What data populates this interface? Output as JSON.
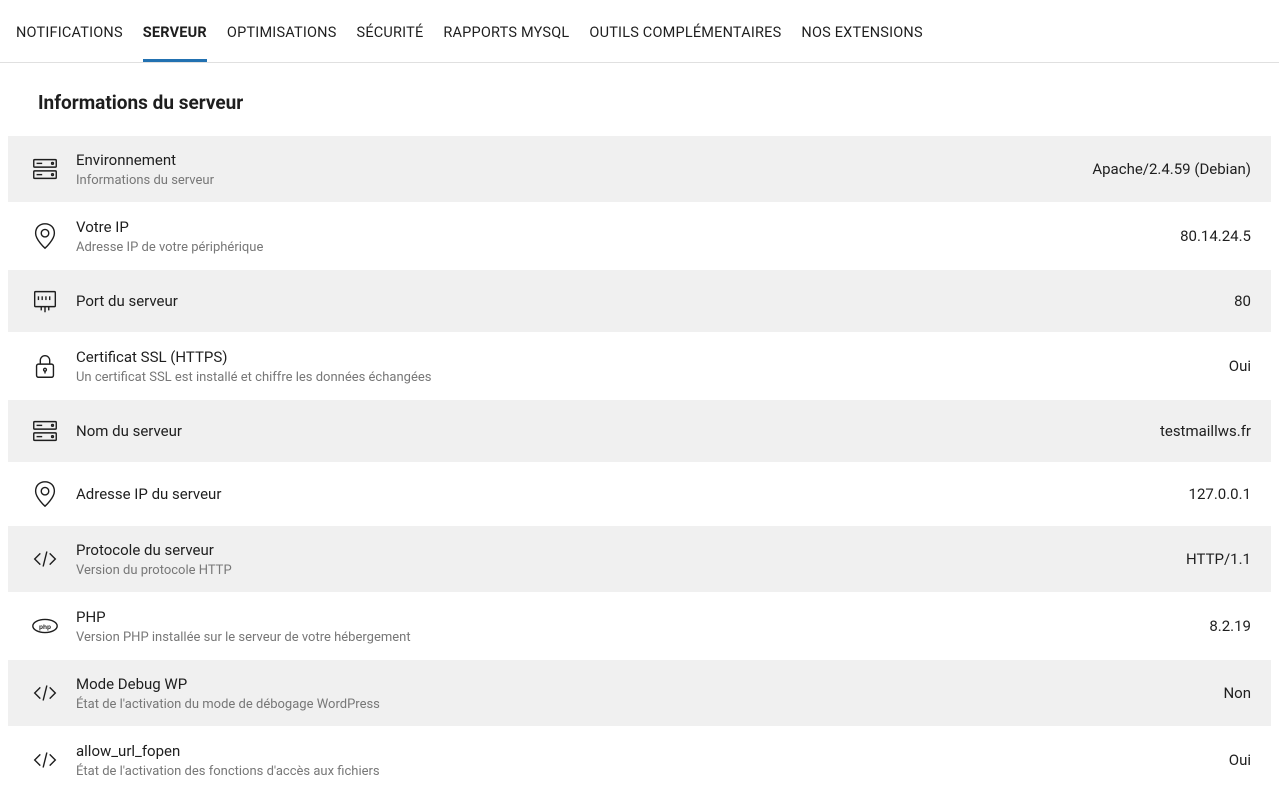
{
  "tabs": [
    {
      "label": "NOTIFICATIONS",
      "active": false
    },
    {
      "label": "SERVEUR",
      "active": true
    },
    {
      "label": "OPTIMISATIONS",
      "active": false
    },
    {
      "label": "SÉCURITÉ",
      "active": false
    },
    {
      "label": "RAPPORTS MYSQL",
      "active": false
    },
    {
      "label": "OUTILS COMPLÉMENTAIRES",
      "active": false
    },
    {
      "label": "NOS EXTENSIONS",
      "active": false
    }
  ],
  "section_title": "Informations du serveur",
  "rows": [
    {
      "icon": "server",
      "title": "Environnement",
      "sub": "Informations du serveur",
      "value": "Apache/2.4.59 (Debian)"
    },
    {
      "icon": "pin",
      "title": "Votre IP",
      "sub": "Adresse IP de votre périphérique",
      "value": "80.14.24.5"
    },
    {
      "icon": "port",
      "title": "Port du serveur",
      "sub": "",
      "value": "80"
    },
    {
      "icon": "lock",
      "title": "Certificat SSL (HTTPS)",
      "sub": "Un certificat SSL est installé et chiffre les données échangées",
      "value": "Oui"
    },
    {
      "icon": "server",
      "title": "Nom du serveur",
      "sub": "",
      "value": "testmaillws.fr"
    },
    {
      "icon": "pin",
      "title": "Adresse IP du serveur",
      "sub": "",
      "value": "127.0.0.1"
    },
    {
      "icon": "code",
      "title": "Protocole du serveur",
      "sub": "Version du protocole HTTP",
      "value": "HTTP/1.1"
    },
    {
      "icon": "php",
      "title": "PHP",
      "sub": "Version PHP installée sur le serveur de votre hébergement",
      "value": "8.2.19"
    },
    {
      "icon": "code",
      "title": "Mode Debug WP",
      "sub": "État de l'activation du mode de débogage WordPress",
      "value": "Non"
    },
    {
      "icon": "code",
      "title": "allow_url_fopen",
      "sub": "État de l'activation des fonctions d'accès aux fichiers",
      "value": "Oui"
    }
  ]
}
